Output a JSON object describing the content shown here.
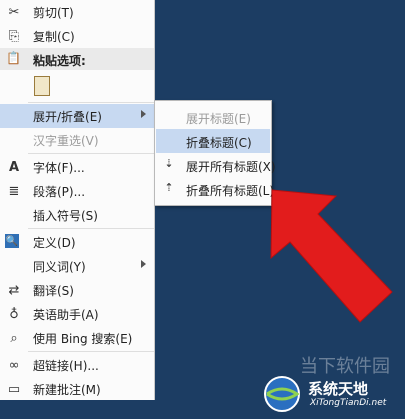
{
  "menu": {
    "items": [
      {
        "label": "剪切(T)",
        "icon": "scissors-icon",
        "glyph": "✂"
      },
      {
        "label": "复制(C)",
        "icon": "copy-icon",
        "glyph": "⎘"
      },
      {
        "label": "粘贴选项:",
        "icon": "clipboard-icon",
        "glyph": "📋"
      },
      {
        "label": "展开/折叠(E)",
        "icon": "",
        "glyph": ""
      },
      {
        "label": "汉字重选(V)",
        "icon": "",
        "glyph": ""
      },
      {
        "label": "字体(F)...",
        "icon": "font-icon",
        "glyph": "A"
      },
      {
        "label": "段落(P)...",
        "icon": "paragraph-icon",
        "glyph": "≣"
      },
      {
        "label": "插入符号(S)",
        "icon": "",
        "glyph": ""
      },
      {
        "label": "定义(D)",
        "icon": "define-icon",
        "glyph": "🔍"
      },
      {
        "label": "同义词(Y)",
        "icon": "",
        "glyph": ""
      },
      {
        "label": "翻译(S)",
        "icon": "translate-icon",
        "glyph": "⇄"
      },
      {
        "label": "英语助手(A)",
        "icon": "english-assistant-icon",
        "glyph": "♁"
      },
      {
        "label": "使用 Bing 搜索(E)",
        "icon": "search-icon",
        "glyph": "⌕"
      },
      {
        "label": "超链接(H)...",
        "icon": "hyperlink-icon",
        "glyph": "∞"
      },
      {
        "label": "新建批注(M)",
        "icon": "comment-icon",
        "glyph": "▭"
      }
    ]
  },
  "submenu": {
    "items": [
      {
        "label": "展开标题(E)"
      },
      {
        "label": "折叠标题(C)"
      },
      {
        "label": "展开所有标题(X)",
        "glyph": "⇣"
      },
      {
        "label": "折叠所有标题(L)",
        "glyph": "⇡"
      }
    ]
  },
  "watermark": {
    "brand": "当下软件园",
    "name": "系统天地",
    "url": "XiTongTianDi.net"
  },
  "colors": {
    "background": "#1c3d63",
    "highlight": "#c7d9f1",
    "arrow": "#e21c1c"
  }
}
